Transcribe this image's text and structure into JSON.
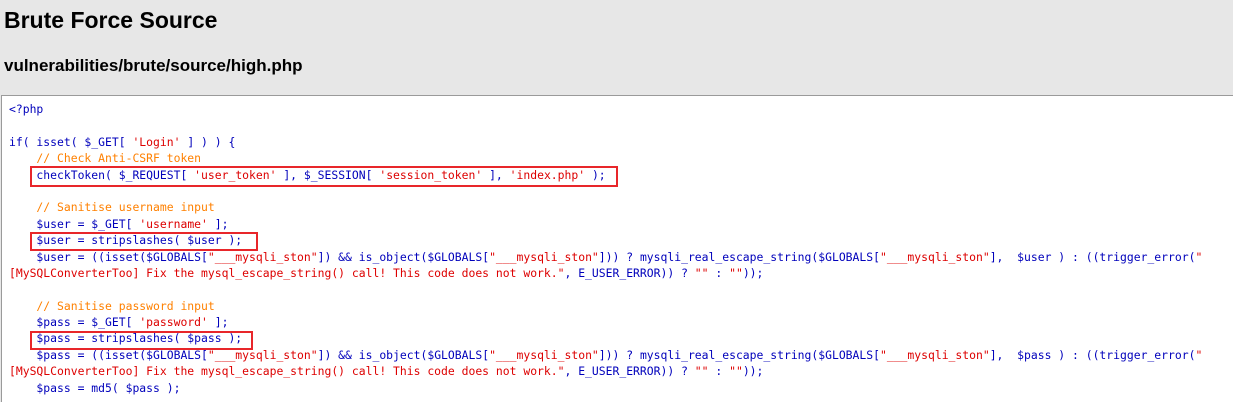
{
  "page": {
    "title": "Brute Force Source",
    "subtitle": "vulnerabilities/brute/source/high.php"
  },
  "code": {
    "lines": [
      [
        {
          "t": "<?php",
          "c": "d"
        }
      ],
      [],
      [
        {
          "t": "if( isset( $_GET[ ",
          "c": "d"
        },
        {
          "t": "'Login'",
          "c": "s"
        },
        {
          "t": " ] ) ) {",
          "c": "d"
        }
      ],
      [
        {
          "t": "    // Check Anti-CSRF token",
          "c": "c"
        }
      ],
      [
        {
          "t": "    checkToken( $_REQUEST[ ",
          "c": "d"
        },
        {
          "t": "'user_token'",
          "c": "s"
        },
        {
          "t": " ], $_SESSION[ ",
          "c": "d"
        },
        {
          "t": "'session_token'",
          "c": "s"
        },
        {
          "t": " ], ",
          "c": "d"
        },
        {
          "t": "'index.php'",
          "c": "s"
        },
        {
          "t": " );",
          "c": "d"
        }
      ],
      [],
      [
        {
          "t": "    // Sanitise username input",
          "c": "c"
        }
      ],
      [
        {
          "t": "    $user = $_GET[ ",
          "c": "d"
        },
        {
          "t": "'username'",
          "c": "s"
        },
        {
          "t": " ];",
          "c": "d"
        }
      ],
      [
        {
          "t": "    $user = stripslashes( $user );",
          "c": "d"
        }
      ],
      [
        {
          "t": "    $user = ((isset($GLOBALS[",
          "c": "d"
        },
        {
          "t": "\"___mysqli_ston\"",
          "c": "s"
        },
        {
          "t": "]) && is_object($GLOBALS[",
          "c": "d"
        },
        {
          "t": "\"___mysqli_ston\"",
          "c": "s"
        },
        {
          "t": "])) ? mysqli_real_escape_string($GLOBALS[",
          "c": "d"
        },
        {
          "t": "\"___mysqli_ston\"",
          "c": "s"
        },
        {
          "t": "],  $user ) : ((trigger_error(",
          "c": "d"
        },
        {
          "t": "\"",
          "c": "s"
        }
      ],
      [
        {
          "t": "[MySQLConverterToo] Fix the mysql_escape_string() call! This code does not work.\"",
          "c": "s"
        },
        {
          "t": ", E_USER_ERROR)) ? ",
          "c": "d"
        },
        {
          "t": "\"\"",
          "c": "s"
        },
        {
          "t": " : ",
          "c": "d"
        },
        {
          "t": "\"\"",
          "c": "s"
        },
        {
          "t": "));",
          "c": "d"
        }
      ],
      [],
      [
        {
          "t": "    // Sanitise password input",
          "c": "c"
        }
      ],
      [
        {
          "t": "    $pass = $_GET[ ",
          "c": "d"
        },
        {
          "t": "'password'",
          "c": "s"
        },
        {
          "t": " ];",
          "c": "d"
        }
      ],
      [
        {
          "t": "    $pass = stripslashes( $pass );",
          "c": "d"
        }
      ],
      [
        {
          "t": "    $pass = ((isset($GLOBALS[",
          "c": "d"
        },
        {
          "t": "\"___mysqli_ston\"",
          "c": "s"
        },
        {
          "t": "]) && is_object($GLOBALS[",
          "c": "d"
        },
        {
          "t": "\"___mysqli_ston\"",
          "c": "s"
        },
        {
          "t": "])) ? mysqli_real_escape_string($GLOBALS[",
          "c": "d"
        },
        {
          "t": "\"___mysqli_ston\"",
          "c": "s"
        },
        {
          "t": "],  $pass ) : ((trigger_error(",
          "c": "d"
        },
        {
          "t": "\"",
          "c": "s"
        }
      ],
      [
        {
          "t": "[MySQLConverterToo] Fix the mysql_escape_string() call! This code does not work.\"",
          "c": "s"
        },
        {
          "t": ", E_USER_ERROR)) ? ",
          "c": "d"
        },
        {
          "t": "\"\"",
          "c": "s"
        },
        {
          "t": " : ",
          "c": "d"
        },
        {
          "t": "\"\"",
          "c": "s"
        },
        {
          "t": "));",
          "c": "d"
        }
      ],
      [
        {
          "t": "    $pass = md5( $pass );",
          "c": "d"
        }
      ]
    ]
  },
  "colors": {
    "default": "#0000bb",
    "comment": "#ff8000",
    "string": "#dd0000",
    "highlight_box": "#e8262a",
    "page_background": "#e7e7e7",
    "code_background": "#ffffff"
  }
}
